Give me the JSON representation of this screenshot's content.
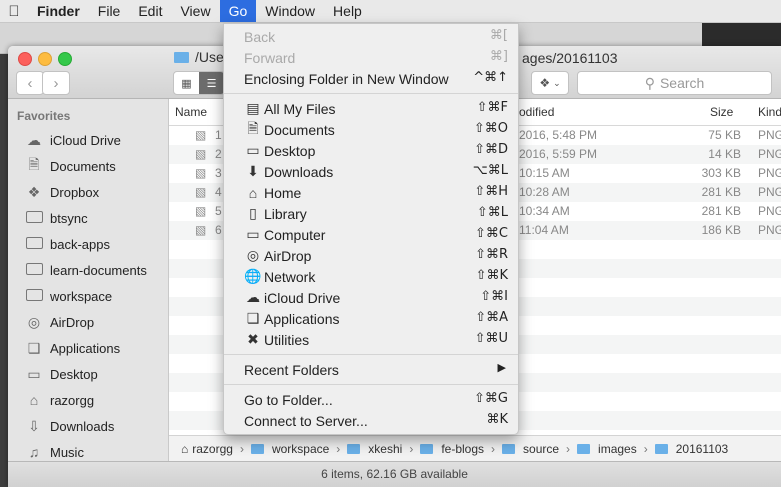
{
  "menubar": {
    "apple": "",
    "items": [
      "Finder",
      "File",
      "Edit",
      "View",
      "Go",
      "Window",
      "Help"
    ]
  },
  "window": {
    "title_left": "/Use",
    "title_right": "ages/20161103",
    "search_placeholder": "Search"
  },
  "sidebar": {
    "section": "Favorites",
    "items": [
      {
        "label": "iCloud Drive",
        "icon": "cloud-icon"
      },
      {
        "label": "Documents",
        "icon": "document-icon"
      },
      {
        "label": "Dropbox",
        "icon": "dropbox-icon"
      },
      {
        "label": "btsync",
        "icon": "folder-icon"
      },
      {
        "label": "back-apps",
        "icon": "folder-icon"
      },
      {
        "label": "learn-documents",
        "icon": "folder-icon"
      },
      {
        "label": "workspace",
        "icon": "folder-icon"
      },
      {
        "label": "AirDrop",
        "icon": "airdrop-icon"
      },
      {
        "label": "Applications",
        "icon": "applications-icon"
      },
      {
        "label": "Desktop",
        "icon": "desktop-icon"
      },
      {
        "label": "razorgg",
        "icon": "home-icon"
      },
      {
        "label": "Downloads",
        "icon": "downloads-icon"
      },
      {
        "label": "Music",
        "icon": "music-icon"
      }
    ]
  },
  "list": {
    "headers": {
      "name": "Name",
      "modified": "odified",
      "size": "Size",
      "kind": "Kind"
    },
    "rows": [
      {
        "name": "1",
        "modified": "2016, 5:48 PM",
        "size": "75 KB",
        "kind": "PNG"
      },
      {
        "name": "2",
        "modified": "2016, 5:59 PM",
        "size": "14 KB",
        "kind": "PNG"
      },
      {
        "name": "3",
        "modified": "10:15 AM",
        "size": "303 KB",
        "kind": "PNG"
      },
      {
        "name": "4",
        "modified": "10:28 AM",
        "size": "281 KB",
        "kind": "PNG"
      },
      {
        "name": "5",
        "modified": "10:34 AM",
        "size": "281 KB",
        "kind": "PNG"
      },
      {
        "name": "6",
        "modified": "11:04 AM",
        "size": "186 KB",
        "kind": "PNG"
      }
    ]
  },
  "pathbar": [
    "razorgg",
    "workspace",
    "xkeshi",
    "fe-blogs",
    "source",
    "images",
    "20161103"
  ],
  "status": "6 items, 62.16 GB available",
  "gomenu": {
    "back": {
      "label": "Back",
      "shortcut": "⌘["
    },
    "forward": {
      "label": "Forward",
      "shortcut": "⌘]"
    },
    "enclosing": {
      "label": "Enclosing Folder in New Window",
      "shortcut": "^⌘↑"
    },
    "places": [
      {
        "label": "All My Files",
        "shortcut": "⇧⌘F",
        "icon": "all-files-icon"
      },
      {
        "label": "Documents",
        "shortcut": "⇧⌘O",
        "icon": "document-icon"
      },
      {
        "label": "Desktop",
        "shortcut": "⇧⌘D",
        "icon": "desktop-icon"
      },
      {
        "label": "Downloads",
        "shortcut": "⌥⌘L",
        "icon": "downloads-icon"
      },
      {
        "label": "Home",
        "shortcut": "⇧⌘H",
        "icon": "home-icon"
      },
      {
        "label": "Library",
        "shortcut": "⇧⌘L",
        "icon": "folder-icon"
      },
      {
        "label": "Computer",
        "shortcut": "⇧⌘C",
        "icon": "computer-icon"
      },
      {
        "label": "AirDrop",
        "shortcut": "⇧⌘R",
        "icon": "airdrop-icon"
      },
      {
        "label": "Network",
        "shortcut": "⇧⌘K",
        "icon": "network-icon"
      },
      {
        "label": "iCloud Drive",
        "shortcut": "⇧⌘I",
        "icon": "cloud-icon"
      },
      {
        "label": "Applications",
        "shortcut": "⇧⌘A",
        "icon": "applications-icon"
      },
      {
        "label": "Utilities",
        "shortcut": "⇧⌘U",
        "icon": "utilities-icon"
      }
    ],
    "recent": {
      "label": "Recent Folders"
    },
    "goto": {
      "label": "Go to Folder...",
      "shortcut": "⇧⌘G"
    },
    "connect": {
      "label": "Connect to Server...",
      "shortcut": "⌘K"
    }
  }
}
